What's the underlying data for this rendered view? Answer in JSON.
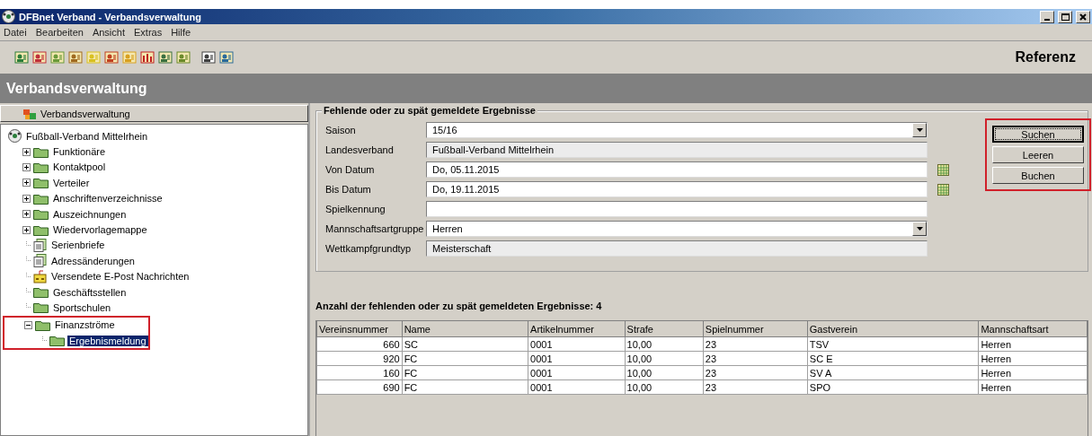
{
  "window": {
    "title": "DFBnet Verband - Verbandsverwaltung"
  },
  "menu": [
    "Datei",
    "Bearbeiten",
    "Ansicht",
    "Extras",
    "Hilfe"
  ],
  "toolbar": {
    "label": "Referenz"
  },
  "header": {
    "title": "Verbandsverwaltung"
  },
  "sidebar": {
    "tab": "Verbandsverwaltung",
    "tree": {
      "label": "Fußball-Verband Mittelrhein",
      "kind": "ball",
      "children": [
        {
          "label": "Funktionäre",
          "kind": "folder",
          "expanded": false,
          "selected": false,
          "highlighted": false
        },
        {
          "label": "Kontaktpool",
          "kind": "folder",
          "expanded": false,
          "selected": false,
          "highlighted": false
        },
        {
          "label": "Verteiler",
          "kind": "folder",
          "expanded": false,
          "selected": false,
          "highlighted": false
        },
        {
          "label": "Anschriftenverzeichnisse",
          "kind": "folder",
          "expanded": false,
          "selected": false,
          "highlighted": false
        },
        {
          "label": "Auszeichnungen",
          "kind": "folder",
          "expanded": false,
          "selected": false,
          "highlighted": false
        },
        {
          "label": "Wiedervorlagemappe",
          "kind": "folder",
          "expanded": false,
          "selected": false,
          "highlighted": false
        },
        {
          "label": "Serienbriefe",
          "kind": "document",
          "selected": false,
          "highlighted": false
        },
        {
          "label": "Adressänderungen",
          "kind": "document",
          "selected": false,
          "highlighted": false
        },
        {
          "label": "Versendete E-Post Nachrichten",
          "kind": "mailbox",
          "selected": false,
          "highlighted": false
        },
        {
          "label": "Geschäftsstellen",
          "kind": "leaf-folder",
          "selected": false,
          "highlighted": false
        },
        {
          "label": "Sportschulen",
          "kind": "leaf-folder",
          "selected": false,
          "highlighted": false
        },
        {
          "label": "Finanzströme",
          "kind": "folder",
          "expanded": true,
          "selected": false,
          "highlighted": true,
          "children": [
            {
              "label": "Ergebnismeldung",
              "kind": "leaf-folder",
              "selected": true,
              "highlighted": false
            }
          ]
        }
      ]
    }
  },
  "form": {
    "title": "Fehlende oder zu spät gemeldete Ergebnisse",
    "fields": [
      {
        "label": "Saison",
        "kind": "dropdown",
        "value": "15/16"
      },
      {
        "label": "Landesverband",
        "kind": "readonly",
        "value": "Fußball-Verband Mittelrhein"
      },
      {
        "label": "Von Datum",
        "kind": "date",
        "value": "Do, 05.11.2015"
      },
      {
        "label": "Bis Datum",
        "kind": "date",
        "value": "Do, 19.11.2015"
      },
      {
        "label": "Spielkennung",
        "kind": "text"
      },
      {
        "label": "Mannschaftsartgruppe",
        "kind": "dropdown",
        "value": "Herren"
      },
      {
        "label": "Wettkampfgrundtyp",
        "kind": "readonly",
        "value": "Meisterschaft"
      }
    ],
    "buttons": [
      {
        "label": "Suchen",
        "focused": true
      },
      {
        "label": "Leeren",
        "focused": false
      },
      {
        "label": "Buchen",
        "focused": false
      }
    ],
    "buttons_highlighted": true
  },
  "result_count": "Anzahl der fehlenden oder zu spät gemeldeten Ergebnisse: 4",
  "table": {
    "columns": [
      "Vereinsnummer",
      "Name",
      "Artikelnummer",
      "Strafe",
      "Spielnummer",
      "Gastverein",
      "Mannschaftsart"
    ],
    "rows": [
      [
        "660",
        "SC",
        "0001",
        "10,00",
        "23",
        "TSV",
        "Herren"
      ],
      [
        "920",
        "FC",
        "0001",
        "10,00",
        "23",
        "SC E",
        "Herren"
      ],
      [
        "160",
        "FC",
        "0001",
        "10,00",
        "23",
        "SV A",
        "Herren"
      ],
      [
        "690",
        "FC",
        "0001",
        "10,00",
        "23",
        "SPO",
        "Herren"
      ]
    ]
  }
}
